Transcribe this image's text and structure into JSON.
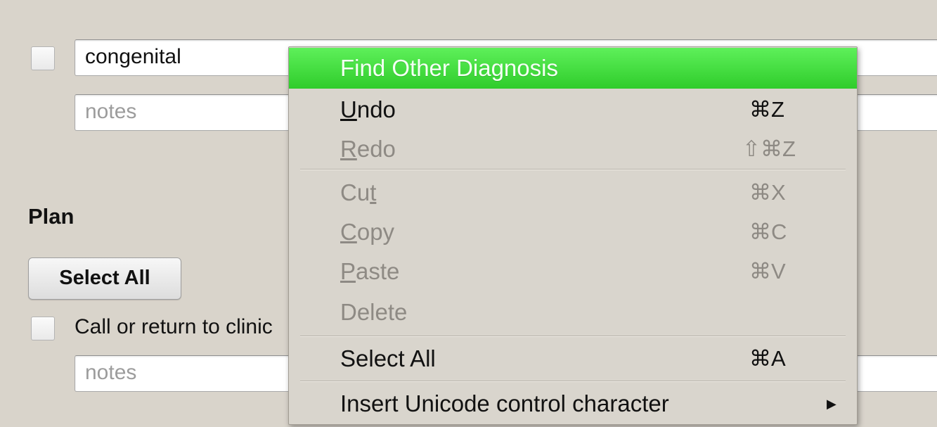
{
  "form": {
    "diagnosis": {
      "value": "congenital",
      "notes_placeholder": "notes"
    },
    "plan": {
      "heading": "Plan",
      "select_all_label": "Select All",
      "item_label": "Call or return to clinic",
      "notes_placeholder": "notes"
    }
  },
  "context_menu": {
    "highlighted": {
      "label": "Find Other Diagnosis"
    },
    "undo": {
      "before": "",
      "mnemonic": "U",
      "after": "ndo",
      "shortcut": "⌘Z",
      "enabled": true
    },
    "redo": {
      "before": "",
      "mnemonic": "R",
      "after": "edo",
      "shortcut": "⇧⌘Z",
      "enabled": false
    },
    "cut": {
      "before": "Cu",
      "mnemonic": "t",
      "after": "",
      "shortcut": "⌘X",
      "enabled": false
    },
    "copy": {
      "before": "",
      "mnemonic": "C",
      "after": "opy",
      "shortcut": "⌘C",
      "enabled": false
    },
    "paste": {
      "before": "",
      "mnemonic": "P",
      "after": "aste",
      "shortcut": "⌘V",
      "enabled": false
    },
    "delete": {
      "label": "Delete",
      "enabled": false
    },
    "select_all": {
      "label": "Select All",
      "shortcut": "⌘A",
      "enabled": true
    },
    "insert_unicode": {
      "label": "Insert Unicode control character",
      "submenu_icon": "submenu-arrow-icon",
      "enabled": true
    }
  },
  "colors": {
    "background": "#d9d4cb",
    "highlight": "#2fcc2b",
    "disabled_text": "#8e8a84"
  }
}
